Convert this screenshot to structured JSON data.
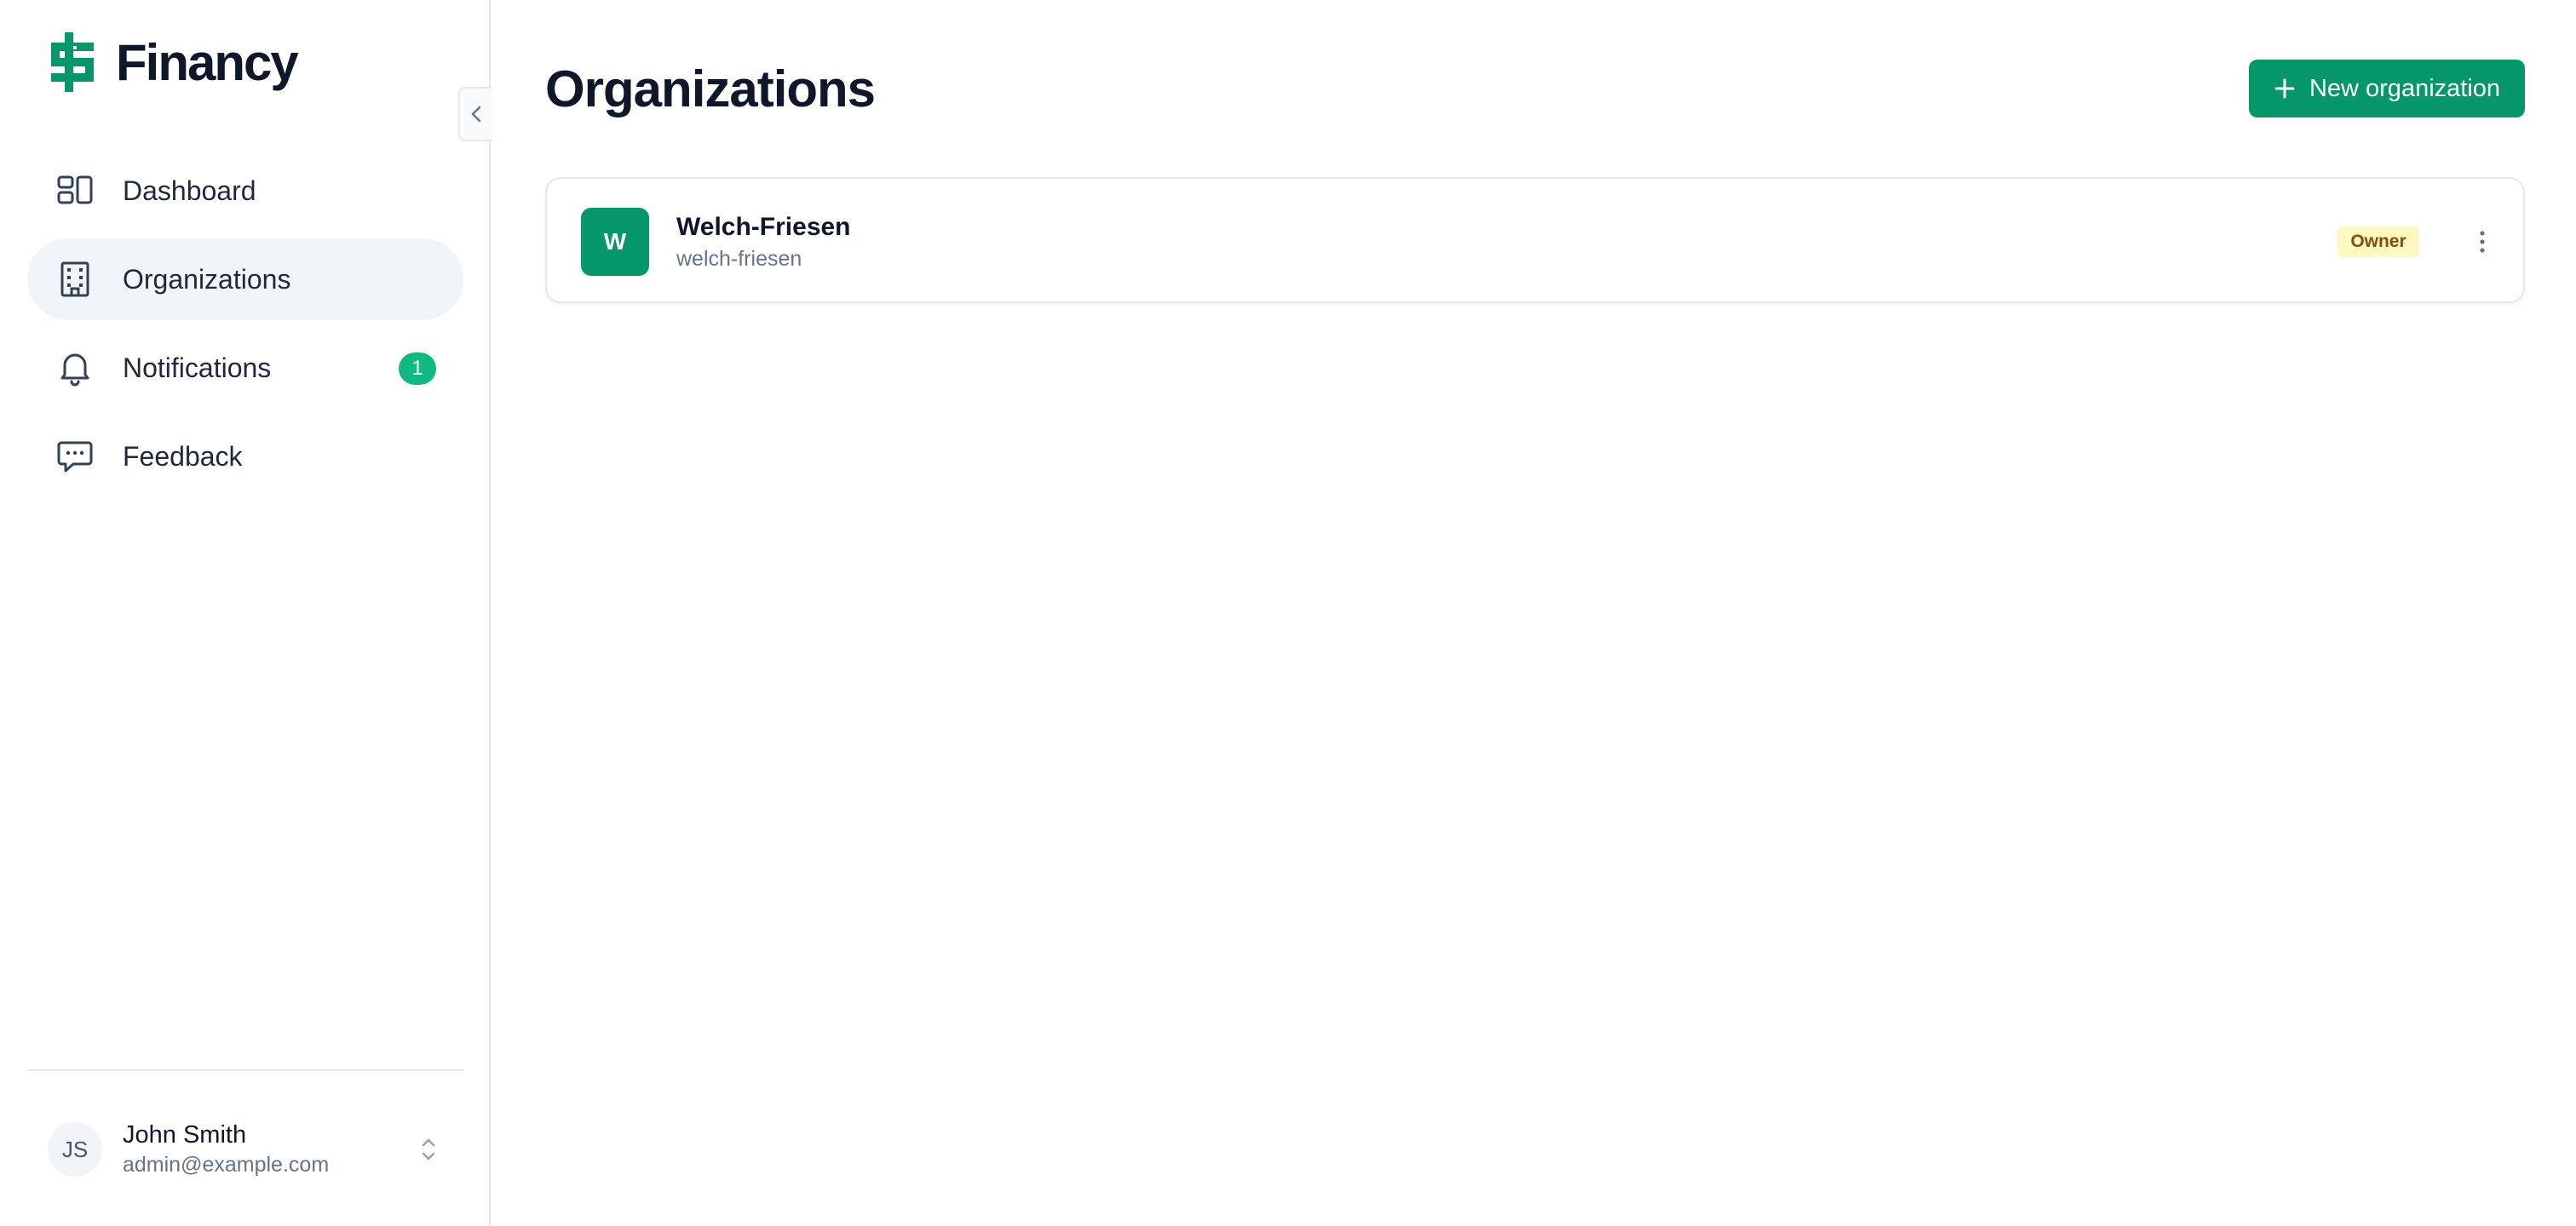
{
  "app": {
    "name": "Financy",
    "logo_icon": "dollar-sign-icon",
    "accent_color": "#059669"
  },
  "sidebar": {
    "collapse_icon": "chevron-left-icon",
    "items": [
      {
        "label": "Dashboard",
        "icon": "dashboard-icon",
        "active": false
      },
      {
        "label": "Organizations",
        "icon": "building-icon",
        "active": true
      },
      {
        "label": "Notifications",
        "icon": "bell-icon",
        "active": false,
        "badge": "1"
      },
      {
        "label": "Feedback",
        "icon": "message-icon",
        "active": false
      }
    ],
    "user": {
      "initials": "JS",
      "name": "John Smith",
      "email": "admin@example.com",
      "menu_icon": "chevrons-up-down-icon"
    }
  },
  "main": {
    "title": "Organizations",
    "new_button": {
      "label": "New organization",
      "icon": "plus-icon"
    },
    "organizations": [
      {
        "initial": "W",
        "name": "Welch-Friesen",
        "slug": "welch-friesen",
        "role": "Owner",
        "menu_icon": "more-vertical-icon"
      }
    ]
  }
}
